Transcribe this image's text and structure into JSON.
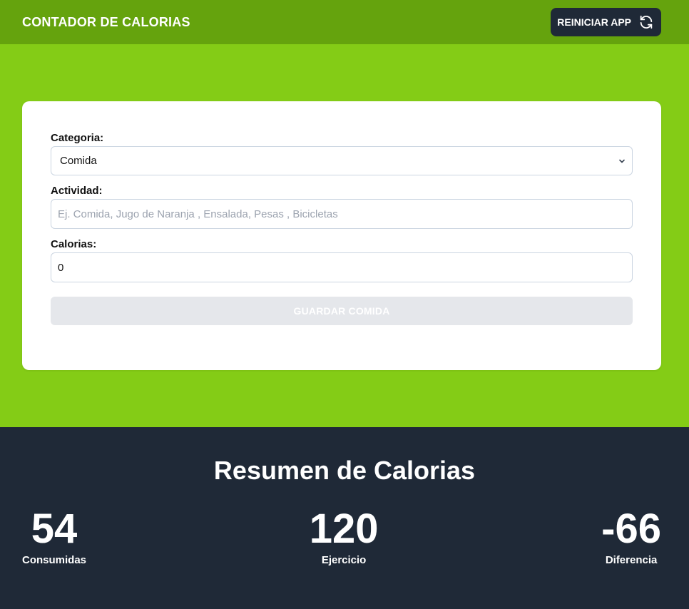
{
  "header": {
    "title": "CONTADOR DE CALORIAS",
    "reset_label": "REINICIAR APP",
    "reset_icon": "refresh-icon"
  },
  "form": {
    "category": {
      "label": "Categoria:",
      "selected": "Comida",
      "options": [
        "Comida"
      ]
    },
    "activity": {
      "label": "Actividad:",
      "value": "",
      "placeholder": "Ej. Comida, Jugo de Naranja , Ensalada, Pesas , Bicicletas"
    },
    "calories": {
      "label": "Calorias:",
      "value": "0"
    },
    "save_label": "GUARDAR COMIDA"
  },
  "summary": {
    "title": "Resumen de Calorias",
    "stats": [
      {
        "value": "54",
        "label": "Consumidas"
      },
      {
        "value": "120",
        "label": "Ejercicio"
      },
      {
        "value": "-66",
        "label": "Diferencia"
      }
    ]
  },
  "colors": {
    "header_bg": "#65a30d",
    "hero_bg": "#84cc16",
    "summary_bg": "#1f2937",
    "button_dark": "#1f2937",
    "button_disabled": "#e5e7eb"
  }
}
